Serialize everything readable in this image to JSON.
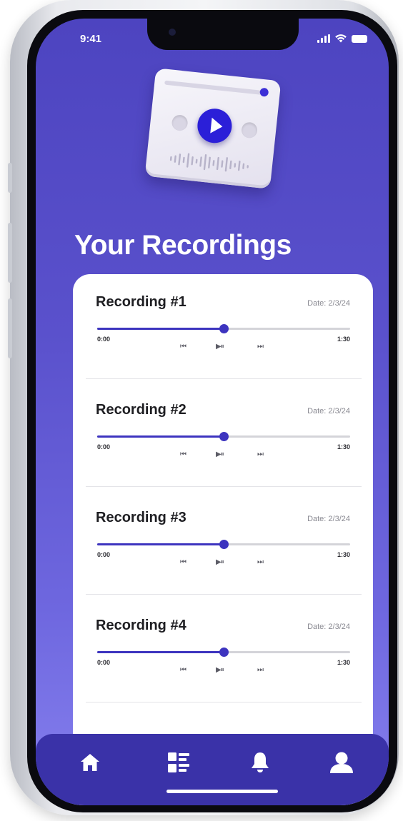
{
  "status_bar": {
    "time": "9:41",
    "icons": [
      "signal-icon",
      "wifi-icon",
      "battery-icon"
    ]
  },
  "illustration": {
    "icon": "music-player-illustration"
  },
  "page": {
    "title": "Your Recordings"
  },
  "recordings": [
    {
      "name": "Recording #1",
      "date": "Date: 2/3/24",
      "elapsed": "0:00",
      "duration": "1:30",
      "progress": 0.5,
      "prev_glyph": "⏮",
      "playpause_glyph": "▶⏸",
      "next_glyph": "⏭"
    },
    {
      "name": "Recording #2",
      "date": "Date: 2/3/24",
      "elapsed": "0:00",
      "duration": "1:30",
      "progress": 0.5,
      "prev_glyph": "⏮",
      "playpause_glyph": "▶⏸",
      "next_glyph": "⏭"
    },
    {
      "name": "Recording #3",
      "date": "Date: 2/3/24",
      "elapsed": "0:00",
      "duration": "1:30",
      "progress": 0.5,
      "prev_glyph": "⏮",
      "playpause_glyph": "▶⏸",
      "next_glyph": "⏭"
    },
    {
      "name": "Recording #4",
      "date": "Date: 2/3/24",
      "elapsed": "0:00",
      "duration": "1:30",
      "progress": 0.5,
      "prev_glyph": "⏮",
      "playpause_glyph": "▶⏸",
      "next_glyph": "⏭"
    }
  ],
  "bottom_nav": {
    "items": [
      "home-icon",
      "list-icon",
      "bell-icon",
      "profile-icon"
    ]
  },
  "colors": {
    "accent": "#3d34bf",
    "background_top": "#4d44c0",
    "background_bottom": "#8680ee",
    "nav_bar": "#3a32a8",
    "card": "#ffffff"
  }
}
